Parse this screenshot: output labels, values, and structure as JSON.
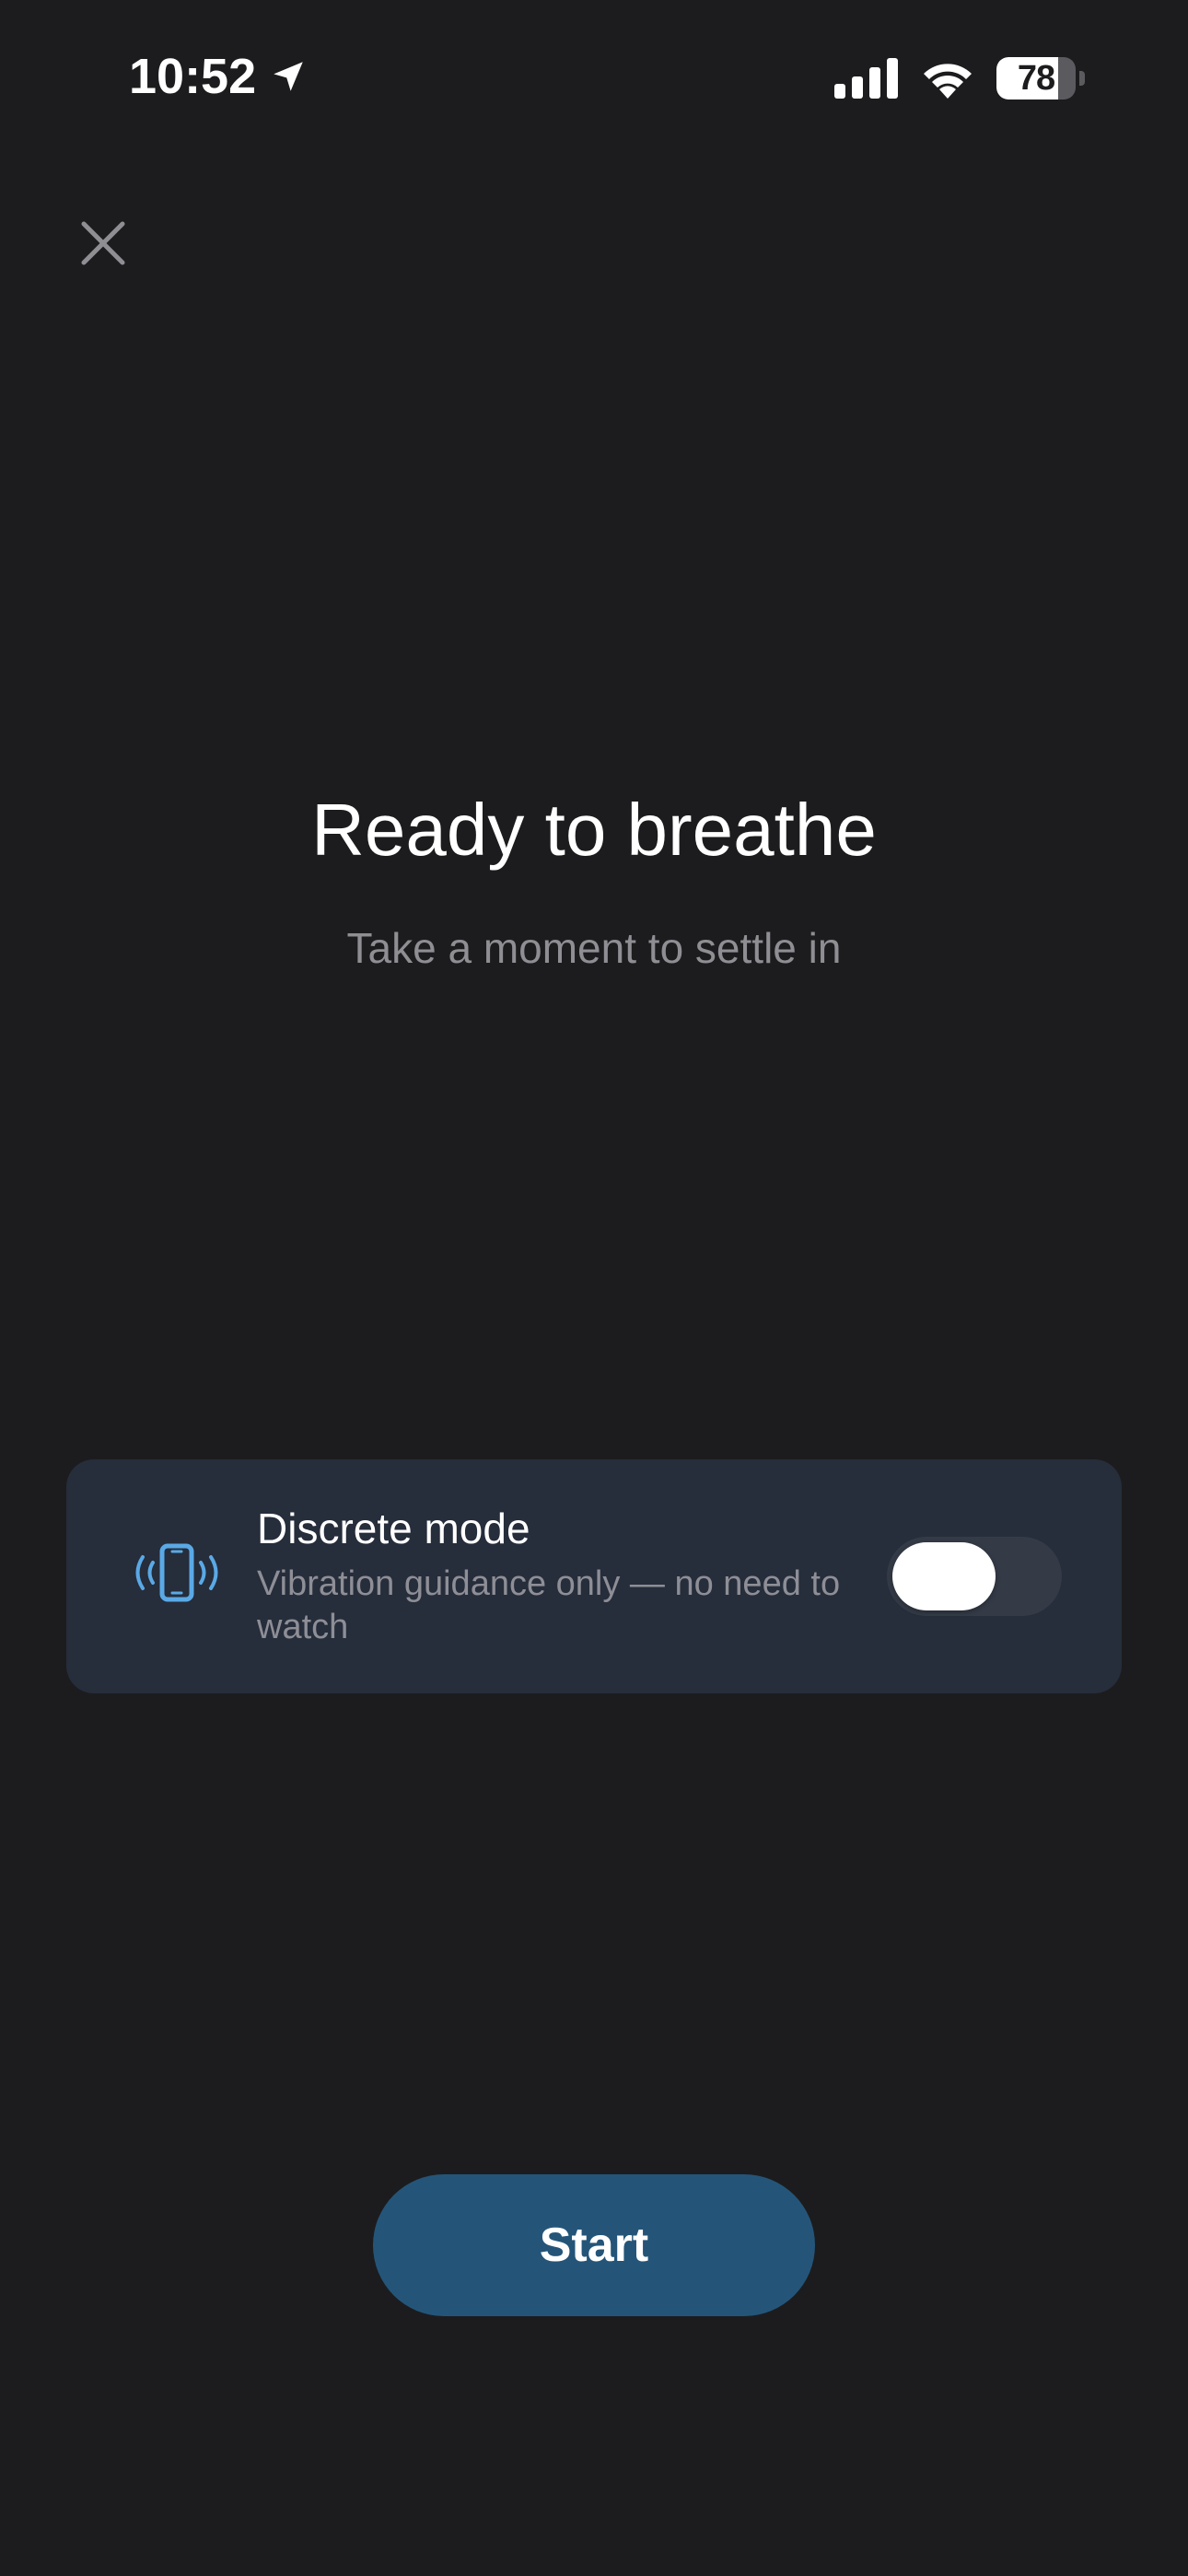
{
  "status_bar": {
    "time": "10:52",
    "battery_level": "78",
    "battery_fraction": 0.78,
    "icons": [
      "location-arrow-icon",
      "signal-icon",
      "wifi-icon",
      "battery-icon"
    ]
  },
  "close": {
    "icon": "close-icon"
  },
  "header": {
    "title": "Ready to breathe",
    "subtitle": "Take a moment to settle in"
  },
  "discrete_mode": {
    "icon": "phone-vibrate-icon",
    "title": "Discrete mode",
    "description": "Vibration guidance only — no need to watch",
    "enabled": false
  },
  "actions": {
    "start_label": "Start"
  },
  "colors": {
    "background": "#1c1c1e",
    "card": "#262d3b",
    "accent": "#245579",
    "icon_blue": "#5aa9e6"
  }
}
